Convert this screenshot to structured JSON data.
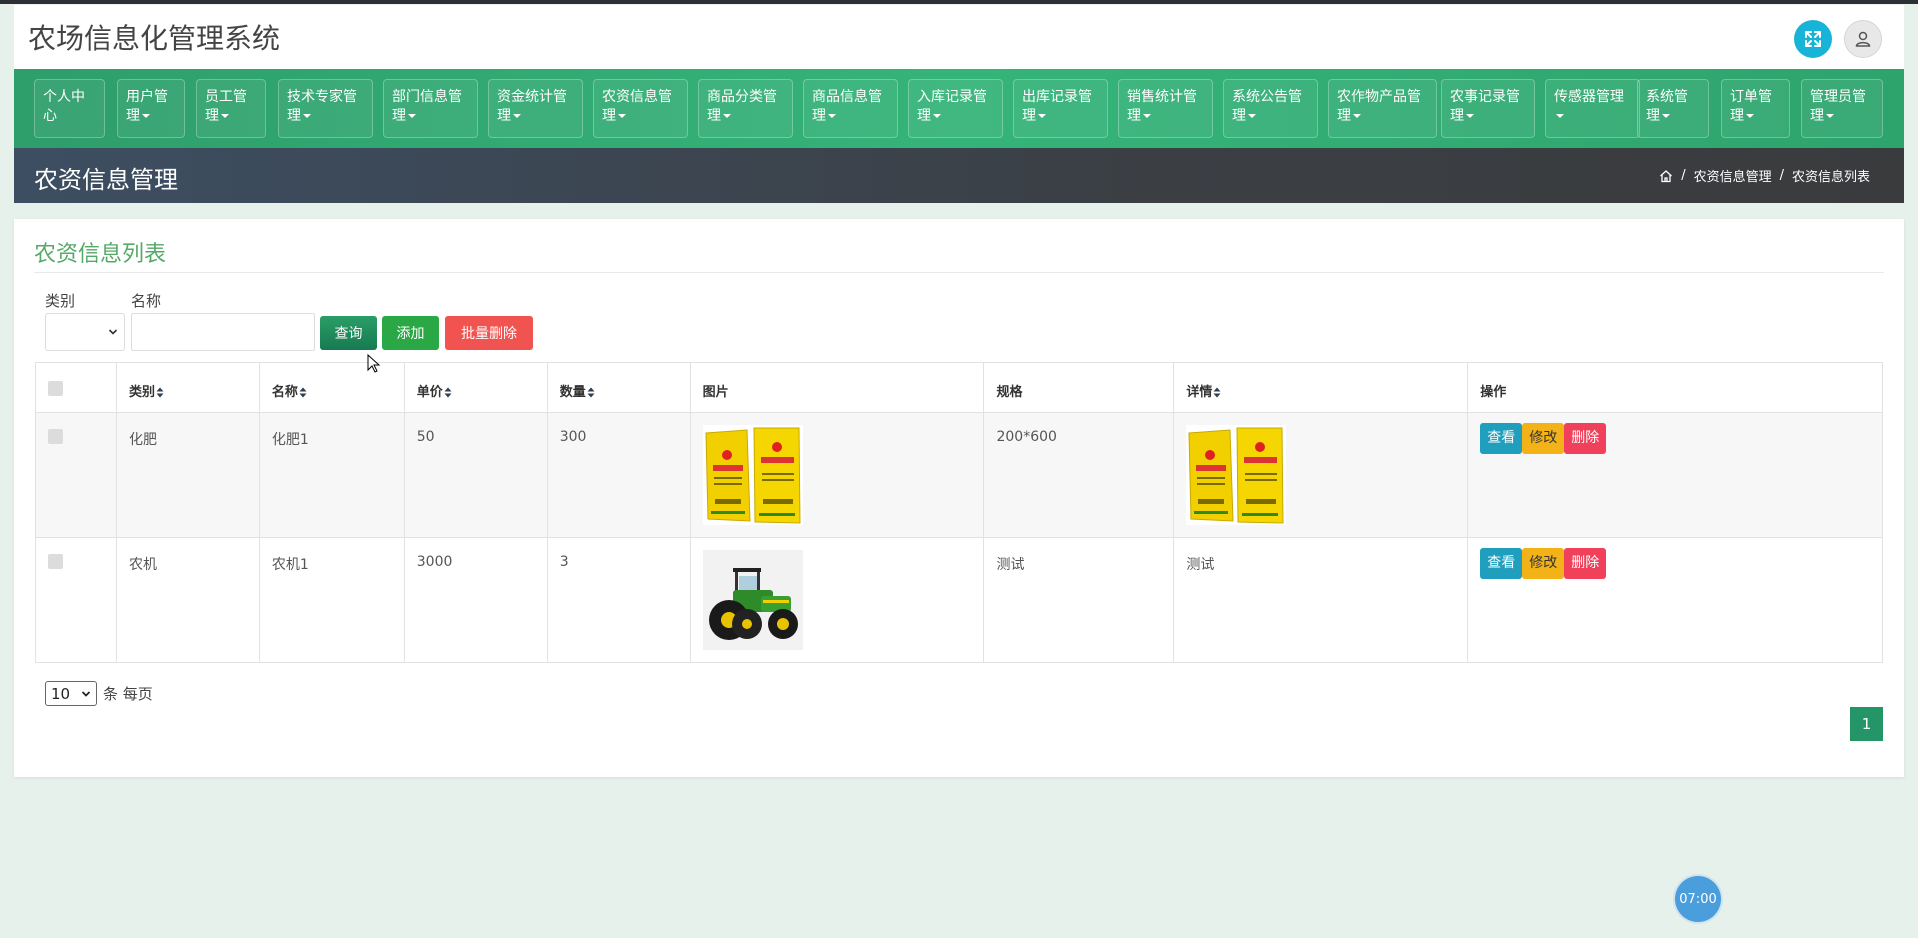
{
  "header": {
    "title": "农场信息化管理系统"
  },
  "icons": {
    "fullscreen": "fullscreen-icon",
    "user": "user-icon"
  },
  "nav": [
    {
      "label": "个人中心"
    },
    {
      "label": "用户管理"
    },
    {
      "label": "员工管理"
    },
    {
      "label": "技术专家管理"
    },
    {
      "label": "部门信息管理"
    },
    {
      "label": "资金统计管理"
    },
    {
      "label": "农资信息管理"
    },
    {
      "label": "商品分类管理"
    },
    {
      "label": "商品信息管理"
    },
    {
      "label": "入库记录管理"
    },
    {
      "label": "出库记录管理"
    },
    {
      "label": "销售统计管理"
    },
    {
      "label": "系统公告管理"
    },
    {
      "label": "农作物产品管理"
    },
    {
      "label": "农事记录管理"
    },
    {
      "label": "传感器管理"
    },
    {
      "label": "系统管理"
    },
    {
      "label": "订单管理"
    },
    {
      "label": "管理员管理"
    }
  ],
  "banner": {
    "title": "农资信息管理",
    "crumb1": "农资信息管理",
    "crumb2": "农资信息列表",
    "sep": "/"
  },
  "panel": {
    "title": "农资信息列表"
  },
  "filters": {
    "category_label": "类别",
    "category_value": "",
    "name_label": "名称",
    "name_value": "",
    "query": "查询",
    "add": "添加",
    "bulk_delete": "批量删除"
  },
  "table": {
    "headers": [
      "类别",
      "名称",
      "单价",
      "数量",
      "图片",
      "规格",
      "详情",
      "操作"
    ],
    "rows": [
      {
        "category": "化肥",
        "name": "化肥1",
        "price": "50",
        "qty": "300",
        "image": "fertilizer-bags",
        "spec": "200*600",
        "detail": "fertilizer-bags"
      },
      {
        "category": "农机",
        "name": "农机1",
        "price": "3000",
        "qty": "3",
        "image": "tractor",
        "spec": "测试",
        "detail": "测试"
      }
    ],
    "actions": {
      "view": "查看",
      "edit": "修改",
      "delete": "删除"
    }
  },
  "pagination": {
    "page_size": "10",
    "per_page_text": "条 每页",
    "current": "1"
  },
  "timer": "07:00",
  "colors": {
    "nav_green": "#35b479",
    "banner_dark": "#3b3f44",
    "title_green": "#55a968",
    "query_green": "#177a52",
    "add_green": "#2aa845",
    "delete_red": "#f05350"
  }
}
